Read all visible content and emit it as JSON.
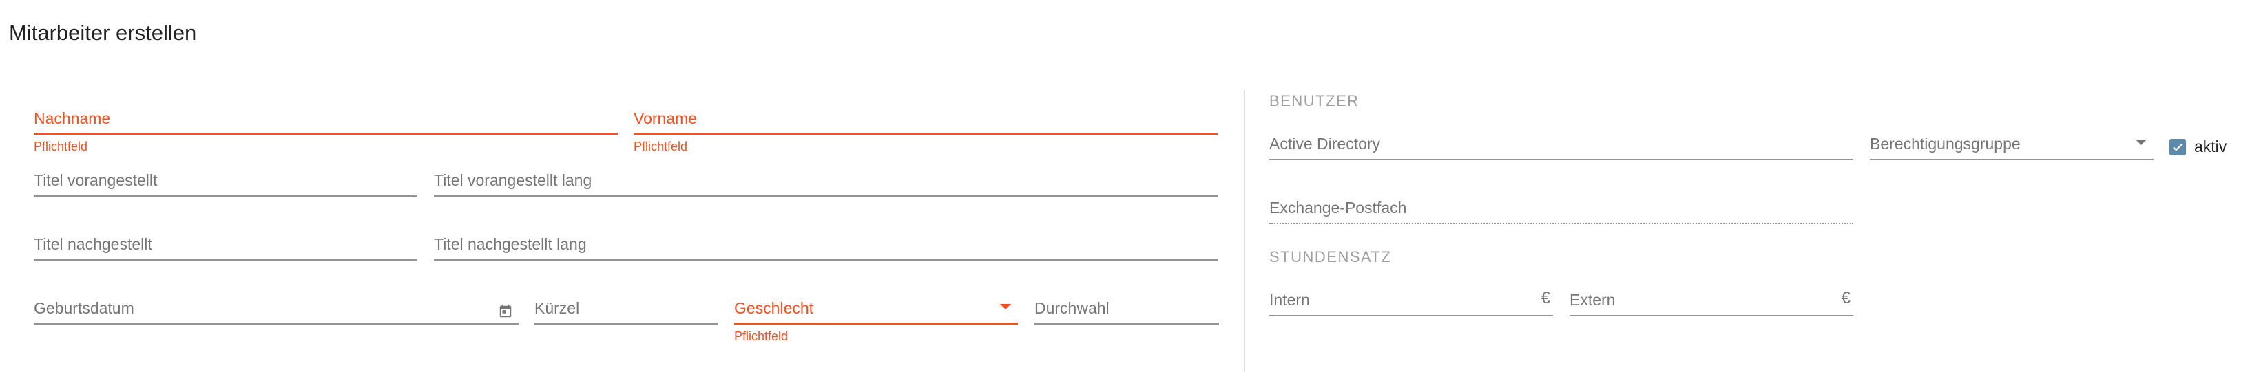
{
  "page": {
    "title": "Mitarbeiter erstellen"
  },
  "colors": {
    "error": "#f4511e",
    "accent": "#5d8aa8"
  },
  "fields": {
    "nachname": {
      "label": "Nachname",
      "hint": "Pflichtfeld"
    },
    "vorname": {
      "label": "Vorname",
      "hint": "Pflichtfeld"
    },
    "titel_vor": {
      "label": "Titel vorangestellt"
    },
    "titel_vor_lang": {
      "label": "Titel vorangestellt lang"
    },
    "titel_nach": {
      "label": "Titel nachgestellt"
    },
    "titel_nach_lang": {
      "label": "Titel nachgestellt lang"
    },
    "geburtsdatum": {
      "label": "Geburtsdatum",
      "icon": "calendar-icon"
    },
    "kuerzel": {
      "label": "Kürzel"
    },
    "geschlecht": {
      "label": "Geschlecht",
      "hint": "Pflichtfeld"
    },
    "durchwahl": {
      "label": "Durchwahl"
    }
  },
  "benutzer": {
    "section": "BENUTZER",
    "active_directory": {
      "label": "Active Directory"
    },
    "berechtigungsgruppe": {
      "label": "Berechtigungsgruppe"
    },
    "aktiv": {
      "label": "aktiv",
      "checked": true
    },
    "exchange": {
      "label": "Exchange-Postfach"
    }
  },
  "stundensatz": {
    "section": "STUNDENSATZ",
    "intern": {
      "label": "Intern",
      "suffix": "€"
    },
    "extern": {
      "label": "Extern",
      "suffix": "€"
    }
  }
}
